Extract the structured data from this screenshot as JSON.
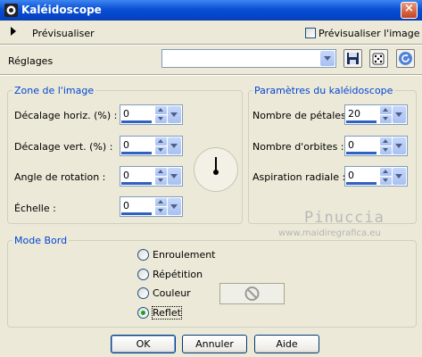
{
  "window": {
    "title": "Kaléidoscope",
    "close_label": "×"
  },
  "preview": {
    "label": "Prévisualiser",
    "checkbox_label": "Prévisualiser l'image",
    "checked": false
  },
  "settings": {
    "label": "Réglages",
    "value": ""
  },
  "image_zone": {
    "title": "Zone de l'image",
    "fields": [
      {
        "label": "Décalage horiz. (%) :",
        "value": "0"
      },
      {
        "label": "Décalage vert. (%) :",
        "value": "0"
      },
      {
        "label": "Angle de rotation :",
        "value": "0"
      },
      {
        "label": "Échelle :",
        "value": "0"
      }
    ]
  },
  "kaleido": {
    "title": "Paramètres du kaléidoscope",
    "fields": [
      {
        "label": "Nombre de pétales :",
        "value": "20"
      },
      {
        "label": "Nombre d'orbites :",
        "value": "0"
      },
      {
        "label": "Aspiration radiale :",
        "value": "0"
      }
    ]
  },
  "edge_mode": {
    "title": "Mode Bord",
    "options": [
      "Enroulement",
      "Répétition",
      "Couleur",
      "Reflet"
    ],
    "selected": "Reflet"
  },
  "buttons": {
    "ok": "OK",
    "cancel": "Annuler",
    "help": "Aide"
  },
  "watermark": {
    "line1": "Pinuccia",
    "line2": "www.maidiregrafica.eu"
  },
  "colors": {
    "titlebar": "#0a4fd4",
    "group_title": "#0046d5",
    "background": "#ece9d8"
  }
}
